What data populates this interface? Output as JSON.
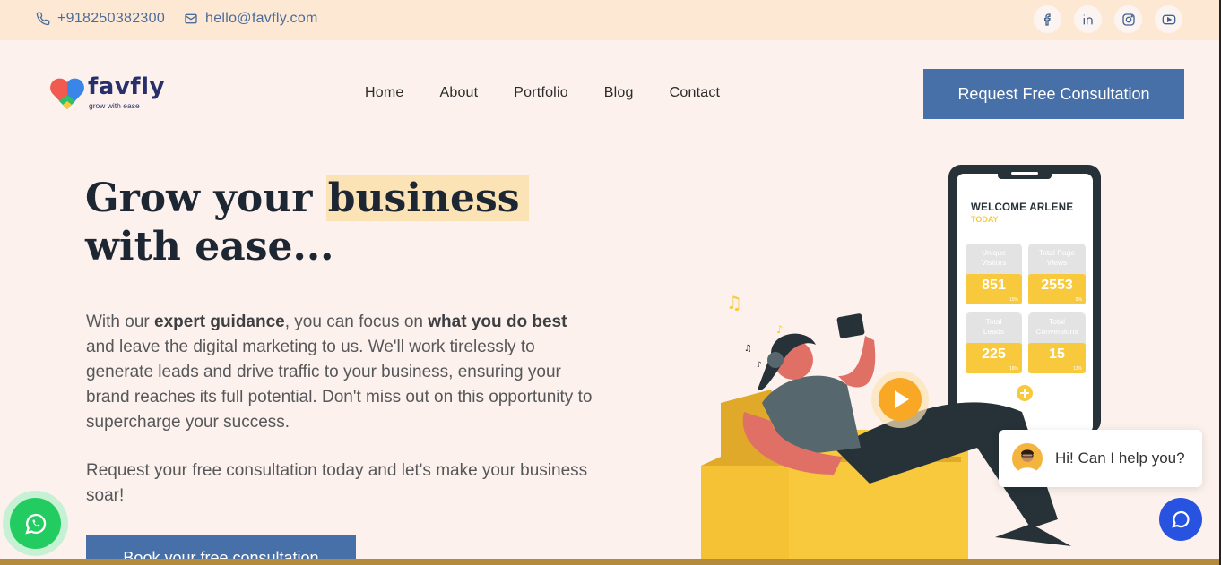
{
  "topbar": {
    "phone": "+918250382300",
    "email": "hello@favfly.com",
    "social": [
      "facebook-icon",
      "linkedin-icon",
      "instagram-icon",
      "youtube-icon"
    ]
  },
  "header": {
    "brand": "favfly",
    "tagline": "grow with ease",
    "nav": [
      "Home",
      "About",
      "Portfolio",
      "Blog",
      "Contact"
    ],
    "cta": "Request Free Consultation"
  },
  "hero": {
    "title_before": "Grow your ",
    "title_highlight": "business",
    "title_after": " with ease...",
    "para1_a": "With our ",
    "para1_b": "expert guidance",
    "para1_c": ", you can focus on ",
    "para1_d": "what you do best",
    "para1_e": " and leave the digital marketing to us. We'll work tirelessly to generate leads and drive traffic to your business, ensuring your brand reaches its full potential. Don't miss out on this opportunity to supercharge your success.",
    "para2": "Request your free consultation today and let's make your business soar!",
    "book_button": "Book your free consultation"
  },
  "phone_mock": {
    "welcome": "WELCOME ARLENE",
    "today": "TODAY",
    "stats": [
      {
        "label": "Unique Visitors",
        "value": "851",
        "pct": "15%"
      },
      {
        "label": "Total Page Views",
        "value": "2553",
        "pct": "9%"
      },
      {
        "label": "Total Leads",
        "value": "225",
        "pct": "18%"
      },
      {
        "label": "Total Conversions",
        "value": "15",
        "pct": "13%"
      }
    ]
  },
  "chat": {
    "greeting": "Hi! Can I help you?"
  },
  "colors": {
    "topbar_bg": "#fde8d4",
    "page_bg": "#fcf1ec",
    "primary_blue": "#4870a8",
    "highlight": "#fbe3b5",
    "whatsapp": "#22cc61",
    "chat_blue": "#2753e0",
    "stat_yellow": "#f9c93d"
  }
}
